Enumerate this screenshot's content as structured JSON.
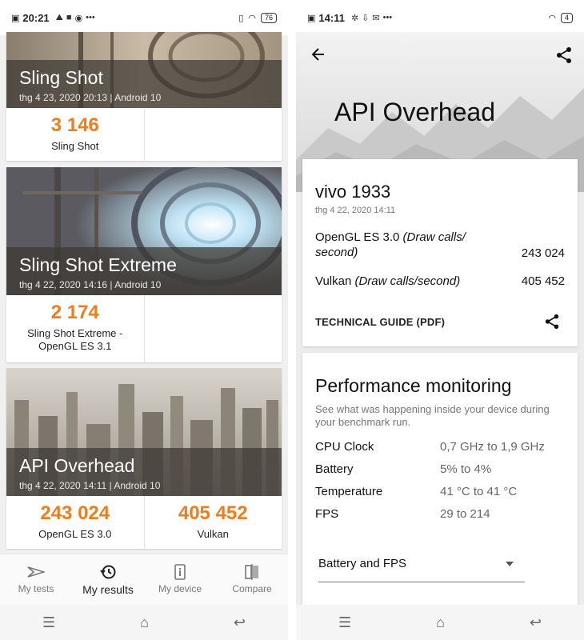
{
  "left_status": {
    "time": "20:21",
    "battery": "76"
  },
  "right_status": {
    "time": "14:11",
    "battery": "4"
  },
  "left_cards": [
    {
      "title": "Sling Shot",
      "subtitle": "thg 4 23, 2020 20:13 | Android 10",
      "scores": [
        {
          "value": "3 146",
          "label": "Sling Shot"
        }
      ]
    },
    {
      "title": "Sling Shot Extreme",
      "subtitle": "thg 4 22, 2020 14:16 | Android 10",
      "scores": [
        {
          "value": "2 174",
          "label_line1": "Sling Shot Extreme -",
          "label_line2": "OpenGL ES 3.1"
        }
      ]
    },
    {
      "title": "API Overhead",
      "subtitle": "thg 4 22, 2020 14:11 | Android 10",
      "scores": [
        {
          "value": "243 024",
          "label": "OpenGL ES 3.0"
        },
        {
          "value": "405 452",
          "label": "Vulkan"
        }
      ]
    }
  ],
  "tabs": [
    "My tests",
    "My results",
    "My device",
    "Compare"
  ],
  "right": {
    "title": "API Overhead",
    "device": "vivo 1933",
    "date": "thg 4 22, 2020 14:11",
    "opengl_label": "OpenGL ES 3.0",
    "opengl_unit_1": "(Draw calls/",
    "opengl_unit_2": "second)",
    "opengl_value": "243 024",
    "vulkan_label": "Vulkan",
    "vulkan_unit": "(Draw calls/second)",
    "vulkan_value": "405 452",
    "tech_guide": "TECHNICAL GUIDE (PDF)",
    "pm_title": "Performance monitoring",
    "pm_desc": "See what was happening inside your device during your benchmark run.",
    "pm_rows": [
      {
        "k": "CPU Clock",
        "v": "0,7 GHz to 1,9 GHz"
      },
      {
        "k": "Battery",
        "v": "5% to 4%"
      },
      {
        "k": "Temperature",
        "v": "41 °C to 41 °C"
      },
      {
        "k": "FPS",
        "v": "29 to 214"
      }
    ],
    "select_value": "Battery and FPS"
  },
  "colors": {
    "accent": "#f07c1c"
  }
}
